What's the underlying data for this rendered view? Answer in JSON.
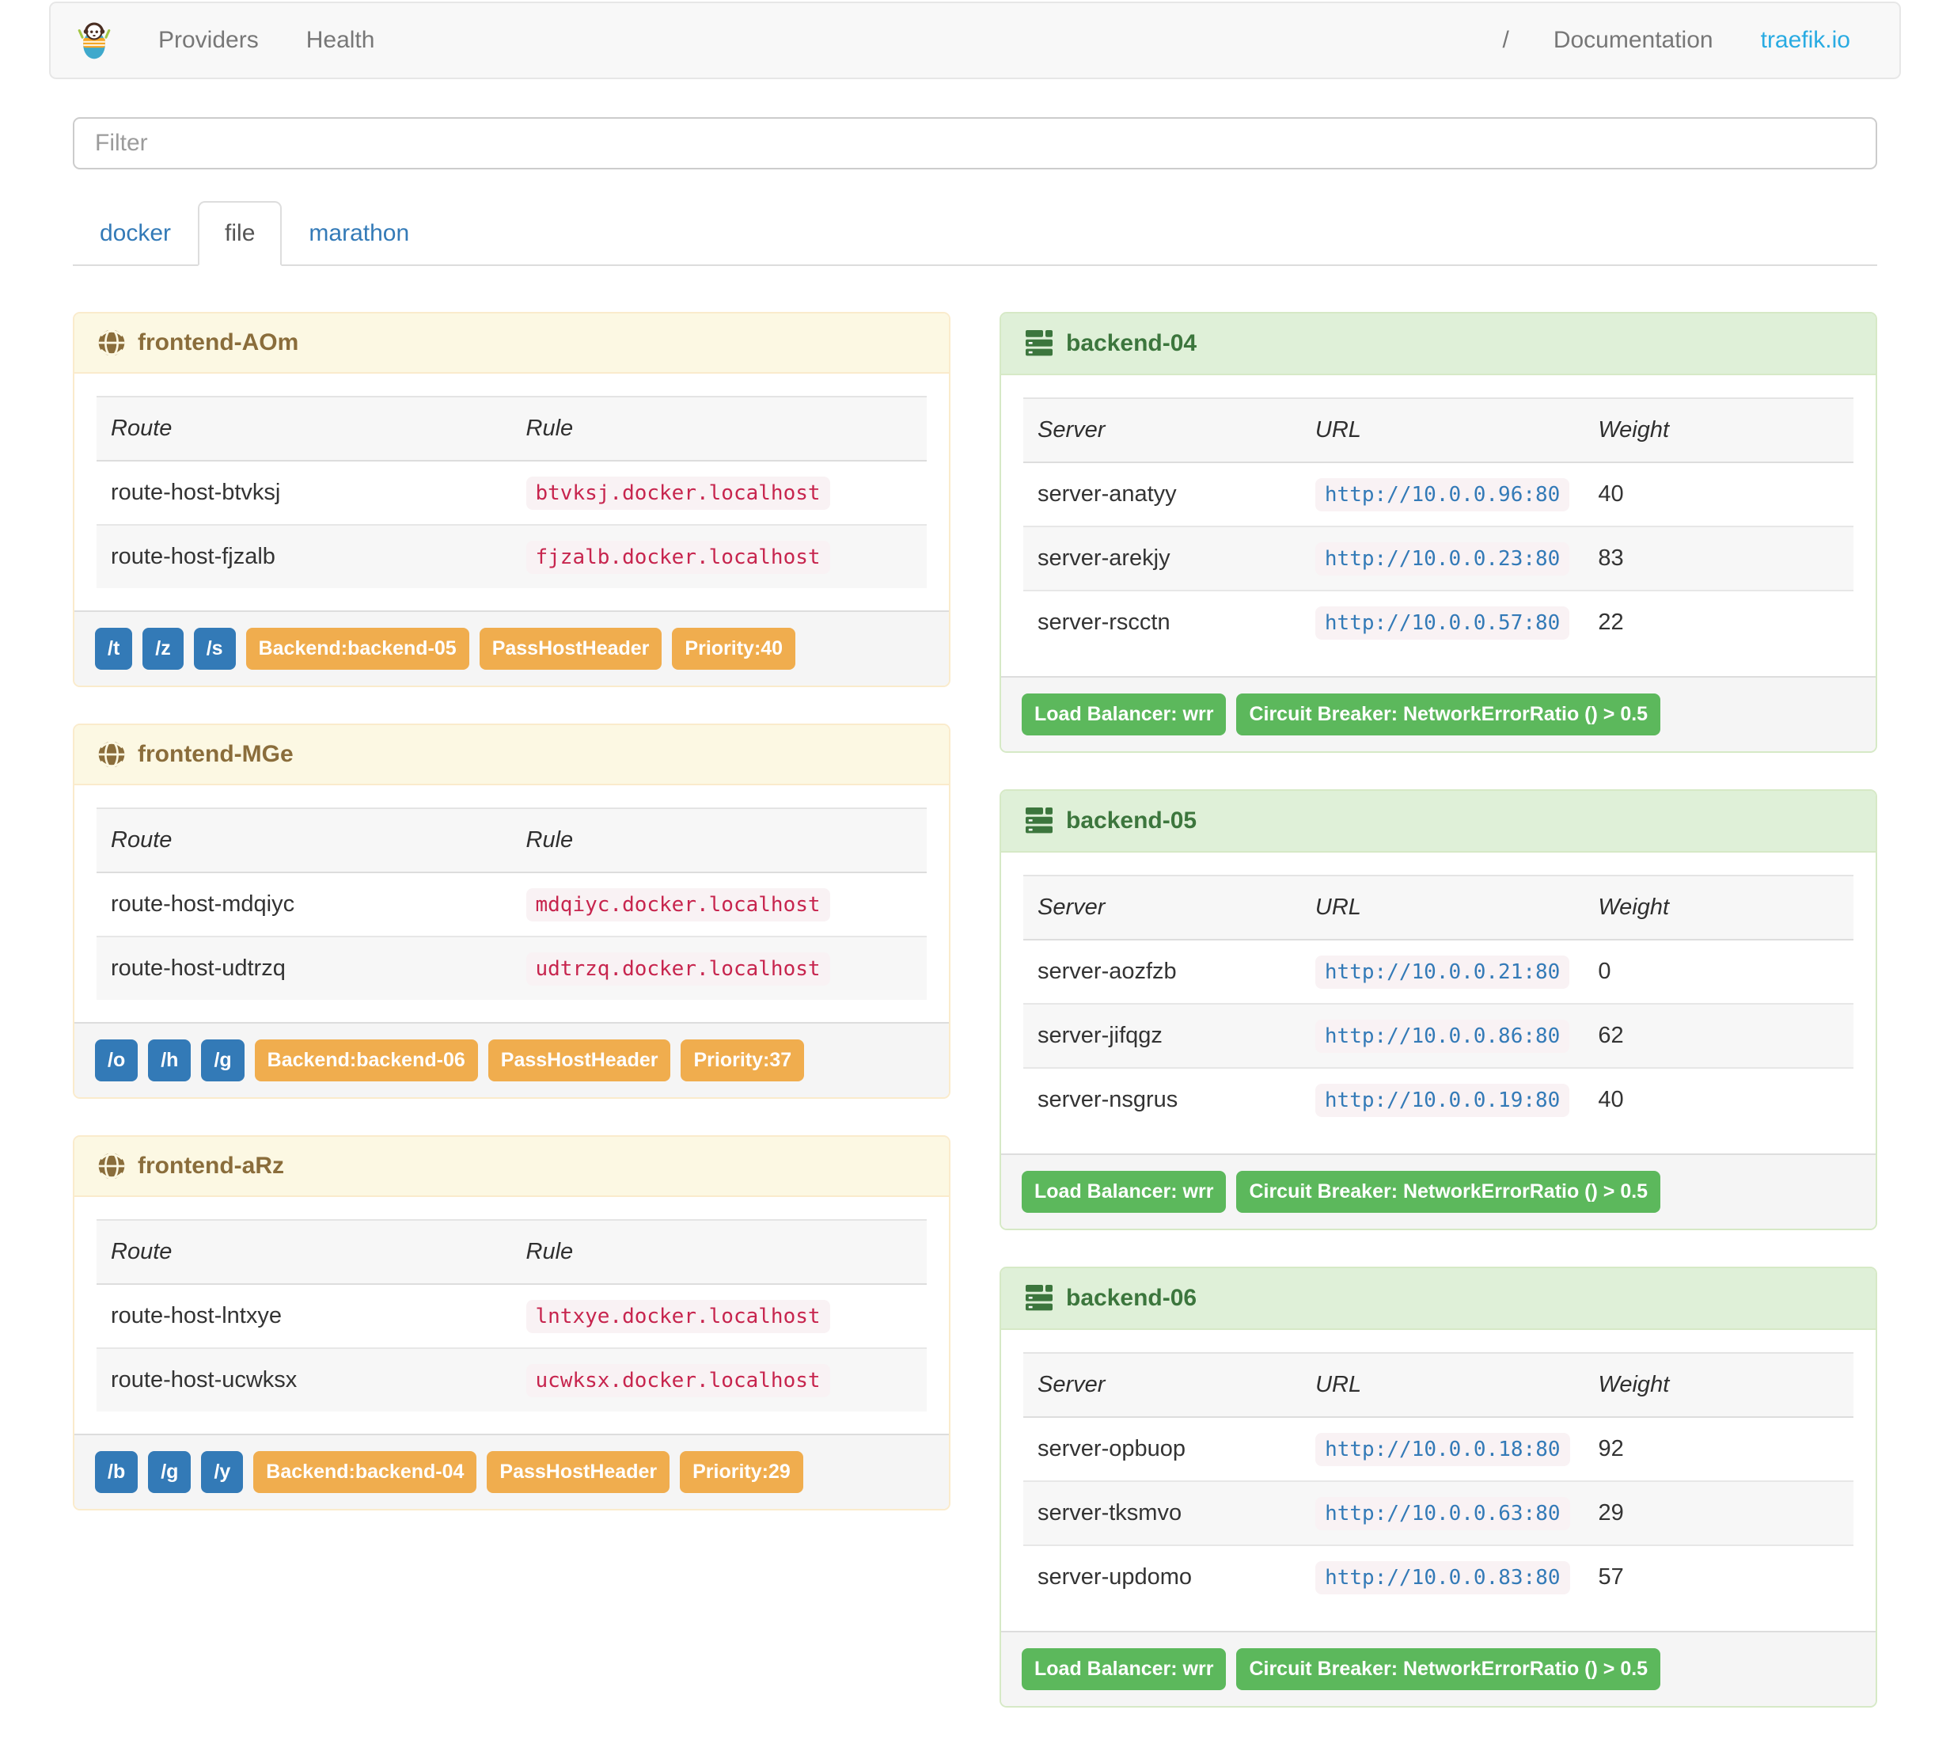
{
  "navbar": {
    "left_items": [
      {
        "id": "providers",
        "label": "Providers"
      },
      {
        "id": "health",
        "label": "Health"
      }
    ],
    "separator": "/",
    "right_items": [
      {
        "id": "documentation",
        "label": "Documentation"
      },
      {
        "id": "traefik-io",
        "label": "traefik.io"
      }
    ]
  },
  "filter": {
    "placeholder": "Filter"
  },
  "tabs": [
    {
      "label": "docker",
      "active": false
    },
    {
      "label": "file",
      "active": true
    },
    {
      "label": "marathon",
      "active": false
    }
  ],
  "frontend_table_columns": [
    "Route",
    "Rule"
  ],
  "backend_table_columns": [
    "Server",
    "URL",
    "Weight"
  ],
  "frontends": [
    {
      "title": "frontend-AOm",
      "routes": [
        {
          "route": "route-host-btvksj",
          "rule": "btvksj.docker.localhost"
        },
        {
          "route": "route-host-fjzalb",
          "rule": "fjzalb.docker.localhost"
        }
      ],
      "entry_point_badges": [
        "/t",
        "/z",
        "/s"
      ],
      "detail_badges": [
        "Backend:backend-05",
        "PassHostHeader",
        "Priority:40"
      ]
    },
    {
      "title": "frontend-MGe",
      "routes": [
        {
          "route": "route-host-mdqiyc",
          "rule": "mdqiyc.docker.localhost"
        },
        {
          "route": "route-host-udtrzq",
          "rule": "udtrzq.docker.localhost"
        }
      ],
      "entry_point_badges": [
        "/o",
        "/h",
        "/g"
      ],
      "detail_badges": [
        "Backend:backend-06",
        "PassHostHeader",
        "Priority:37"
      ]
    },
    {
      "title": "frontend-aRz",
      "routes": [
        {
          "route": "route-host-lntxye",
          "rule": "lntxye.docker.localhost"
        },
        {
          "route": "route-host-ucwksx",
          "rule": "ucwksx.docker.localhost"
        }
      ],
      "entry_point_badges": [
        "/b",
        "/g",
        "/y"
      ],
      "detail_badges": [
        "Backend:backend-04",
        "PassHostHeader",
        "Priority:29"
      ]
    }
  ],
  "backends": [
    {
      "title": "backend-04",
      "servers": [
        {
          "server": "server-anatyy",
          "url": "http://10.0.0.96:80",
          "weight": "40"
        },
        {
          "server": "server-arekjy",
          "url": "http://10.0.0.23:80",
          "weight": "83"
        },
        {
          "server": "server-rscctn",
          "url": "http://10.0.0.57:80",
          "weight": "22"
        }
      ],
      "footer_badges": [
        "Load Balancer: wrr",
        "Circuit Breaker: NetworkErrorRatio () > 0.5"
      ]
    },
    {
      "title": "backend-05",
      "servers": [
        {
          "server": "server-aozfzb",
          "url": "http://10.0.0.21:80",
          "weight": "0"
        },
        {
          "server": "server-jifqgz",
          "url": "http://10.0.0.86:80",
          "weight": "62"
        },
        {
          "server": "server-nsgrus",
          "url": "http://10.0.0.19:80",
          "weight": "40"
        }
      ],
      "footer_badges": [
        "Load Balancer: wrr",
        "Circuit Breaker: NetworkErrorRatio () > 0.5"
      ]
    },
    {
      "title": "backend-06",
      "servers": [
        {
          "server": "server-opbuop",
          "url": "http://10.0.0.18:80",
          "weight": "92"
        },
        {
          "server": "server-tksmvo",
          "url": "http://10.0.0.63:80",
          "weight": "29"
        },
        {
          "server": "server-updomo",
          "url": "http://10.0.0.83:80",
          "weight": "57"
        }
      ],
      "footer_badges": [
        "Load Balancer: wrr",
        "Circuit Breaker: NetworkErrorRatio () > 0.5"
      ]
    }
  ],
  "colors": {
    "navbar_bg": "#f8f8f8",
    "navbar_border": "#e7e7e7",
    "nav_link": "#777777",
    "brand_link": "#29abe2",
    "tab_link": "#337ab7",
    "frontend_heading_bg": "#fcf8e3",
    "frontend_heading_text": "#8a6d3b",
    "frontend_border": "#faebcc",
    "backend_heading_bg": "#dff0d8",
    "backend_heading_text": "#3c763d",
    "backend_border": "#d6e9c6",
    "footer_bg": "#f5f5f5",
    "badge_blue": "#337ab7",
    "badge_orange": "#f0ad4e",
    "badge_green": "#5cb85c",
    "rule_code_text": "#c7254e",
    "code_bg": "#f9f2f4",
    "url_link": "#337ab7"
  }
}
